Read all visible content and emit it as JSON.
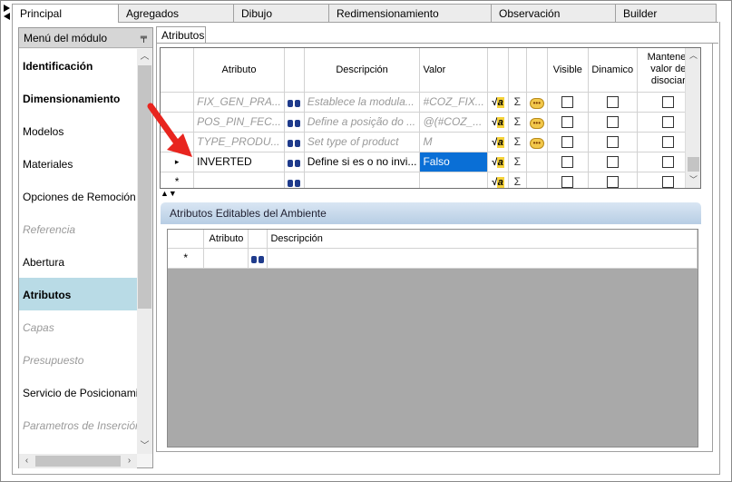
{
  "top_tabs": [
    "Principal",
    "Agregados",
    "Dibujo",
    "Redimensionamiento",
    "Observación",
    "Builder"
  ],
  "sidebar": {
    "title": "Menú del módulo",
    "items": [
      {
        "label": "Identificación",
        "style": "bold"
      },
      {
        "label": "Dimensionamiento",
        "style": "bold"
      },
      {
        "label": "Modelos",
        "style": "normal"
      },
      {
        "label": "Materiales",
        "style": "normal"
      },
      {
        "label": "Opciones de Remoción",
        "style": "normal"
      },
      {
        "label": "Referencia",
        "style": "disabled"
      },
      {
        "label": "Abertura",
        "style": "normal"
      },
      {
        "label": "Atributos",
        "style": "selected"
      },
      {
        "label": "Capas",
        "style": "disabled"
      },
      {
        "label": "Presupuesto",
        "style": "disabled"
      },
      {
        "label": "Servicio de Posicionamiento",
        "style": "normal"
      },
      {
        "label": "Parametros de Inserción",
        "style": "disabled"
      }
    ]
  },
  "panel_tab": "Atributos",
  "attributes_grid": {
    "headers": {
      "atributo": "Atributo",
      "descripcion": "Descripción",
      "valor": "Valor",
      "visible": "Visible",
      "dinamico": "Dinamico",
      "mantener": "Mantener valor de disociar"
    },
    "rows": [
      {
        "marker": "",
        "atributo": "FIX_GEN_PRA...",
        "descripcion": "Establece la modula...",
        "valor": "#COZ_FIX...",
        "readonly": true,
        "bubble": true
      },
      {
        "marker": "",
        "atributo": "POS_PIN_FEC...",
        "descripcion": "Define a posição do ...",
        "valor": "@(#COZ_...",
        "readonly": true,
        "bubble": true
      },
      {
        "marker": "",
        "atributo": "TYPE_PRODU...",
        "descripcion": "Set type of product",
        "valor": "M",
        "readonly": true,
        "bubble": true
      },
      {
        "marker": "▸",
        "atributo": "INVERTED",
        "descripcion": "Define si es o no invi...",
        "valor": "Falso",
        "readonly": false,
        "bubble": false,
        "selected_value": true
      },
      {
        "marker": "*",
        "atributo": "",
        "descripcion": "",
        "valor": "",
        "readonly": false,
        "bubble": false,
        "new_row": true
      }
    ],
    "sigma": "Σ"
  },
  "splitter_arrows": "▲▼",
  "env_section": {
    "title": "Atributos Editables del Ambiente",
    "headers": {
      "atributo": "Atributo",
      "descripcion": "Descripción"
    },
    "new_row_marker": "*"
  },
  "colors": {
    "selected_value_bg": "#0a6fd6",
    "sidebar_selected": "#b9dbe6",
    "arrow": "#e8251f"
  }
}
